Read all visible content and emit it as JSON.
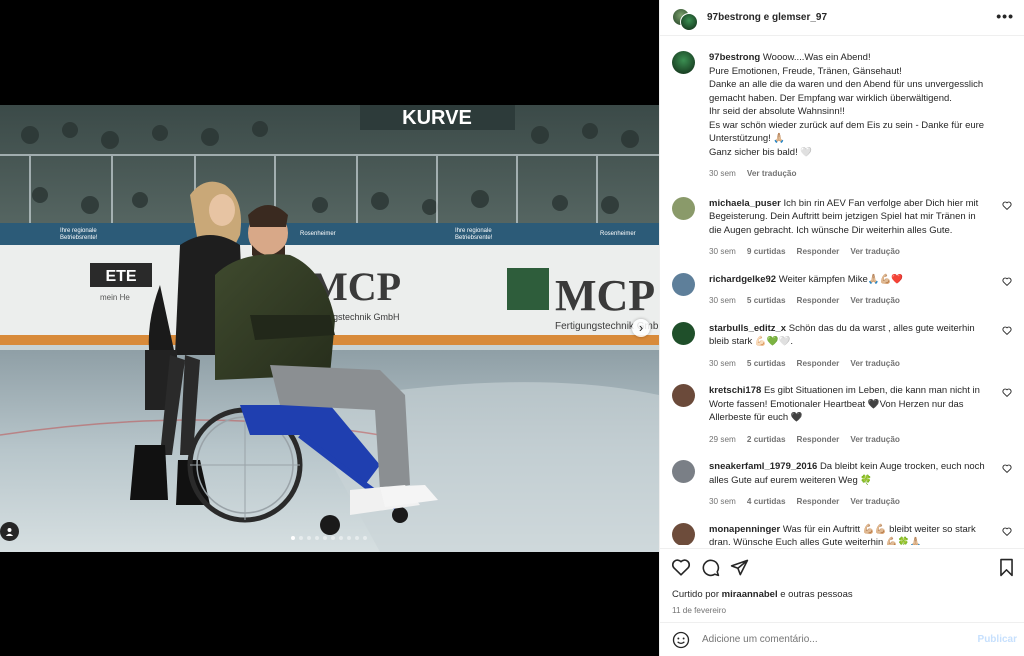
{
  "header": {
    "users_text": "97bestrong e glemser_97",
    "more_label": "•••"
  },
  "photo": {
    "banner_text": "KURVE",
    "sponsor_main": "MCP",
    "sponsor_sub": "Fertigungstechnik GmbH",
    "sponsor_left": "ETE",
    "sponsor_left_sub": "mein He",
    "board_text": "Rosenheimer",
    "board_sub": "Betriebsrente!",
    "board_small": "Ihre regionale",
    "slide_count": 10,
    "active_slide": 0,
    "next_label": "›"
  },
  "caption": {
    "username": "97bestrong",
    "text": "Wooow....Was ein Abend!\nPure Emotionen, Freude, Tränen, Gänsehaut!\nDanke an alle die da waren und den Abend für uns unvergesslich gemacht haben. Der Empfang war wirklich überwältigend.\nIhr seid der absolute Wahnsinn!!\nEs war schön wieder zurück auf dem Eis zu sein - Danke für eure Unterstützung! 🙏🏼\nGanz sicher bis bald! 🤍",
    "time": "30 sem",
    "translate": "Ver tradução"
  },
  "comments": [
    {
      "username": "michaela_puser",
      "text": "Ich bin rin AEV Fan verfolge aber Dich hier mit Begeisterung. Dein Auftritt beim jetzigen Spiel hat mir Tränen in die Augen gebracht. Ich wünsche Dir weiterhin alles Gute.",
      "time": "30 sem",
      "likes": "9 curtidas",
      "reply": "Responder",
      "translate": "Ver tradução",
      "avatar_color": "#8a9a6a"
    },
    {
      "username": "richardgelke92",
      "text": "Weiter kämpfen Mike🙏🏼💪🏼❤️",
      "time": "30 sem",
      "likes": "5 curtidas",
      "reply": "Responder",
      "translate": "Ver tradução",
      "avatar_color": "#5e7f9a"
    },
    {
      "username": "starbulls_editz_x",
      "text": "Schön das du da warst , alles gute weiterhin bleib stark 💪🏻💚🤍.",
      "time": "30 sem",
      "likes": "5 curtidas",
      "reply": "Responder",
      "translate": "Ver tradução",
      "avatar_color": "#1f4f2a"
    },
    {
      "username": "kretschi178",
      "text": "Es gibt Situationen im Leben, die kann man nicht in Worte fassen! Emotionaler Heartbeat 🖤Von Herzen nur das Allerbeste für euch 🖤",
      "time": "29 sem",
      "likes": "2 curtidas",
      "reply": "Responder",
      "translate": "Ver tradução",
      "avatar_color": "#6b4a3a"
    },
    {
      "username": "sneakerfaml_1979_2016",
      "text": "Da bleibt kein Auge trocken, euch noch alles Gute auf eurem weiteren Weg 🍀",
      "time": "30 sem",
      "likes": "4 curtidas",
      "reply": "Responder",
      "translate": "Ver tradução",
      "avatar_color": "#7a7f86"
    },
    {
      "username": "monapenninger",
      "text": "Was für ein Auftritt 💪🏼💪🏼 bleibt weiter so stark dran. Wünsche Euch alles Gute weiterhin 💪🏼🍀🙏🏼",
      "time": "",
      "likes": "",
      "reply": "",
      "translate": "",
      "avatar_color": "#6d4c3b"
    }
  ],
  "actions": {
    "liked_prefix": "Curtido por",
    "liked_user": "miraannabel",
    "liked_suffix": "e outras pessoas",
    "date": "11 de fevereiro"
  },
  "add_comment": {
    "placeholder": "Adicione um comentário...",
    "post_label": "Publicar"
  },
  "colors": {
    "accent_blue": "#0095f6",
    "muted": "#737373",
    "heart_red": "#ed4956",
    "ice": "#b9c7cc"
  }
}
